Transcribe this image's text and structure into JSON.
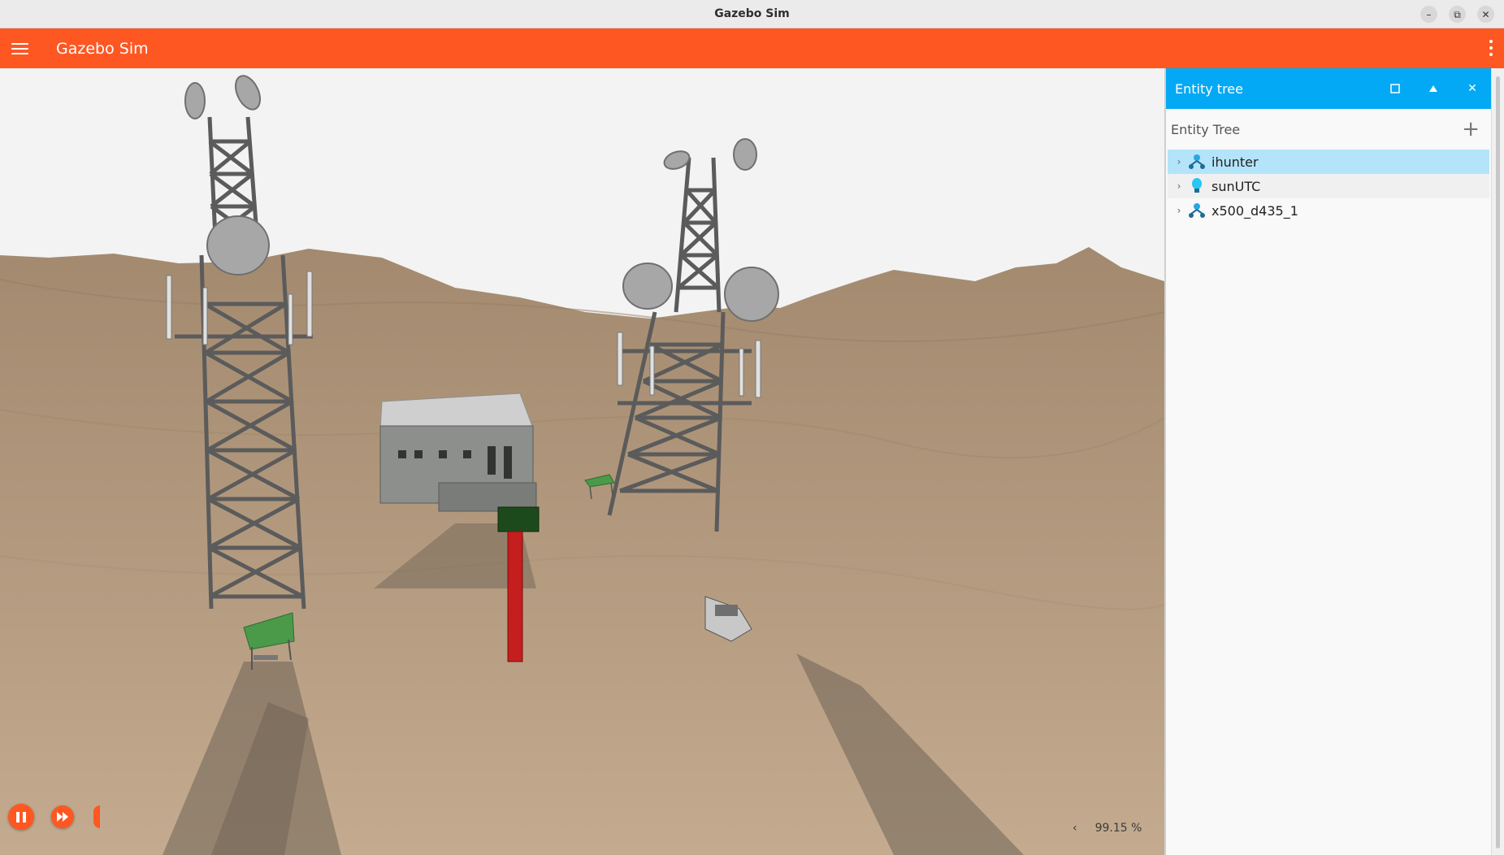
{
  "window": {
    "title": "Gazebo Sim",
    "controls": [
      "minimize-icon",
      "restore-icon",
      "close-icon"
    ]
  },
  "toolbar": {
    "title": "Gazebo Sim",
    "color": "#fe5722",
    "menu_icon": "hamburger-icon",
    "more_icon": "kebab-icon"
  },
  "viewport": {
    "play_state": "pause-icon",
    "step_icon": "fast-forward-icon",
    "real_time_factor": "99.15 %",
    "collapse_icon": "chevron-left-icon"
  },
  "panel": {
    "title": "Entity tree",
    "header_color": "#03a9f4",
    "subtitle": "Entity Tree",
    "add_icon": "plus-icon",
    "entities": [
      {
        "name": "ihunter",
        "icon": "model-icon",
        "selected": true
      },
      {
        "name": "sunUTC",
        "icon": "light-bulb-icon",
        "selected": false
      },
      {
        "name": "x500_d435_1",
        "icon": "model-icon",
        "selected": false
      }
    ]
  }
}
